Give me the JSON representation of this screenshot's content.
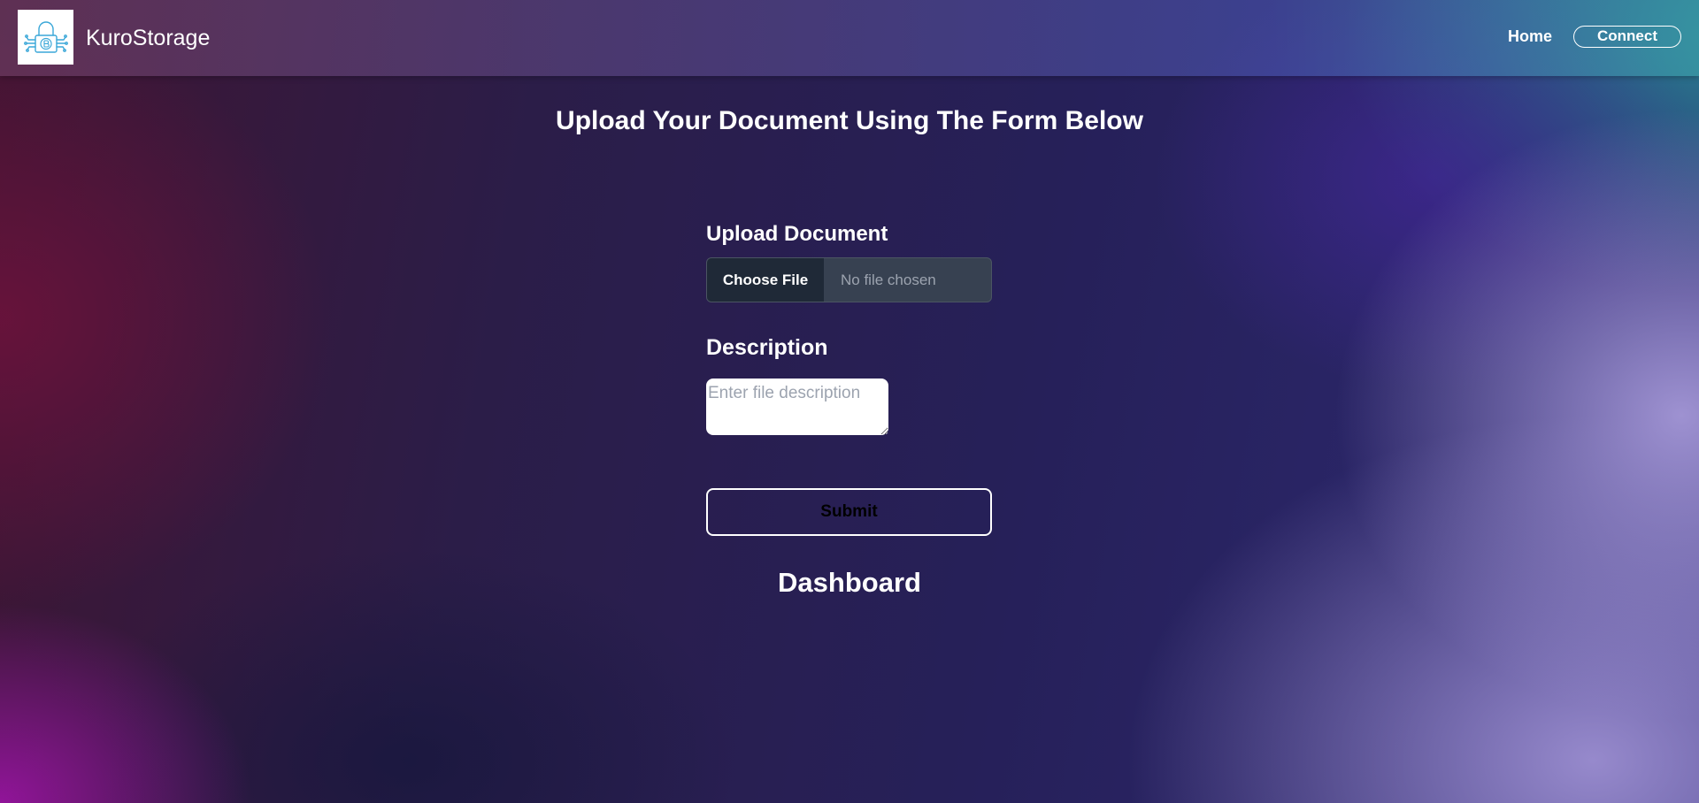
{
  "header": {
    "brand": "KuroStorage",
    "logo_icon": "padlock-circuit-icon",
    "nav": {
      "home": "Home",
      "connect": "Connect"
    }
  },
  "main": {
    "title": "Upload Your Document Using The Form Below",
    "upload_label": "Upload Document",
    "file_input": {
      "button_label": "Choose File",
      "status": "No file chosen"
    },
    "description_label": "Description",
    "description_placeholder": "Enter file description",
    "submit_label": "Submit",
    "dashboard_title": "Dashboard"
  },
  "colors": {
    "accent_logo": "#3aa7d8",
    "text": "#ffffff",
    "file_button_bg": "#1f2937",
    "file_input_bg": "#374151"
  }
}
